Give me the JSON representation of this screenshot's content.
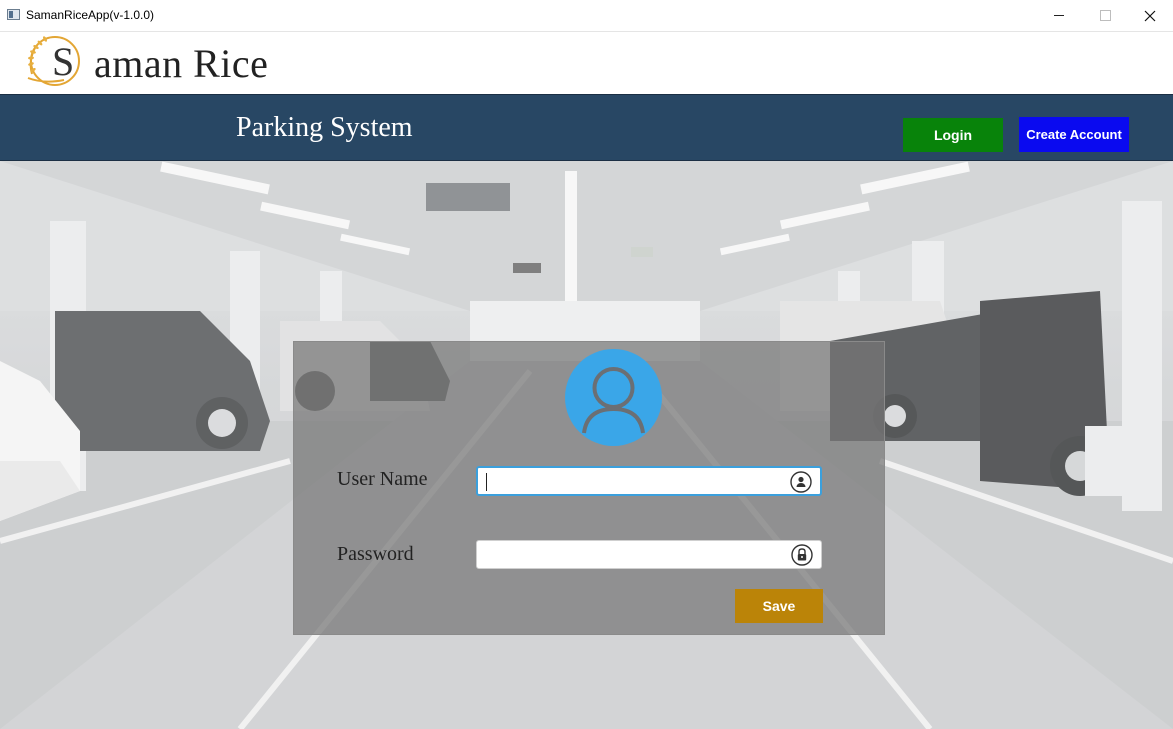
{
  "window": {
    "title": "SamanRiceApp(v-1.0.0)"
  },
  "brand": {
    "initial": "S",
    "rest": "aman Rice"
  },
  "header": {
    "title": "Parking System",
    "login_label": "Login",
    "create_account_label": "Create Account"
  },
  "form": {
    "username_label": "User Name",
    "username_value": "",
    "password_label": "Password",
    "password_value": "",
    "save_label": "Save"
  },
  "colors": {
    "nav_bg": "#284764",
    "login_btn": "#08830a",
    "create_btn": "#0a0af0",
    "save_btn": "#bb8408",
    "avatar": "#3aa6e8",
    "focus_border": "#3ba0dd"
  },
  "icons": {
    "username": "user-lock-icon",
    "password": "padlock-icon",
    "avatar": "user-avatar-icon",
    "logo": "rice-wheat-logo-icon"
  }
}
